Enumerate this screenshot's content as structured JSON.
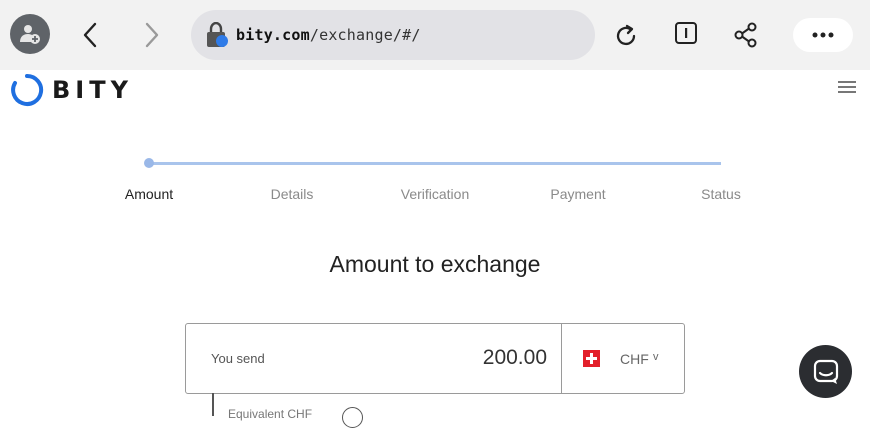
{
  "browser": {
    "url_domain": "bity.com",
    "url_path": "/exchange/#/",
    "icons": [
      "profile-icon",
      "back-icon",
      "forward-icon",
      "lock-icon",
      "reload-icon",
      "reader-icon",
      "share-icon",
      "more-icon"
    ]
  },
  "site": {
    "logo_text": "BITY",
    "menu_icon": "hamburger-icon",
    "brand_color": "#1f6fe0"
  },
  "stepper": {
    "steps": [
      {
        "label": "Amount",
        "active": true
      },
      {
        "label": "Details",
        "active": false
      },
      {
        "label": "Verification",
        "active": false
      },
      {
        "label": "Payment",
        "active": false
      },
      {
        "label": "Status",
        "active": false
      }
    ]
  },
  "exchange": {
    "heading": "Amount to exchange",
    "send_label": "You send",
    "send_amount": "200.00",
    "currency": "CHF",
    "currency_chevron": "v",
    "equivalent_partial": "Equivalent CHF"
  },
  "chat": {
    "icon": "chat-icon"
  }
}
